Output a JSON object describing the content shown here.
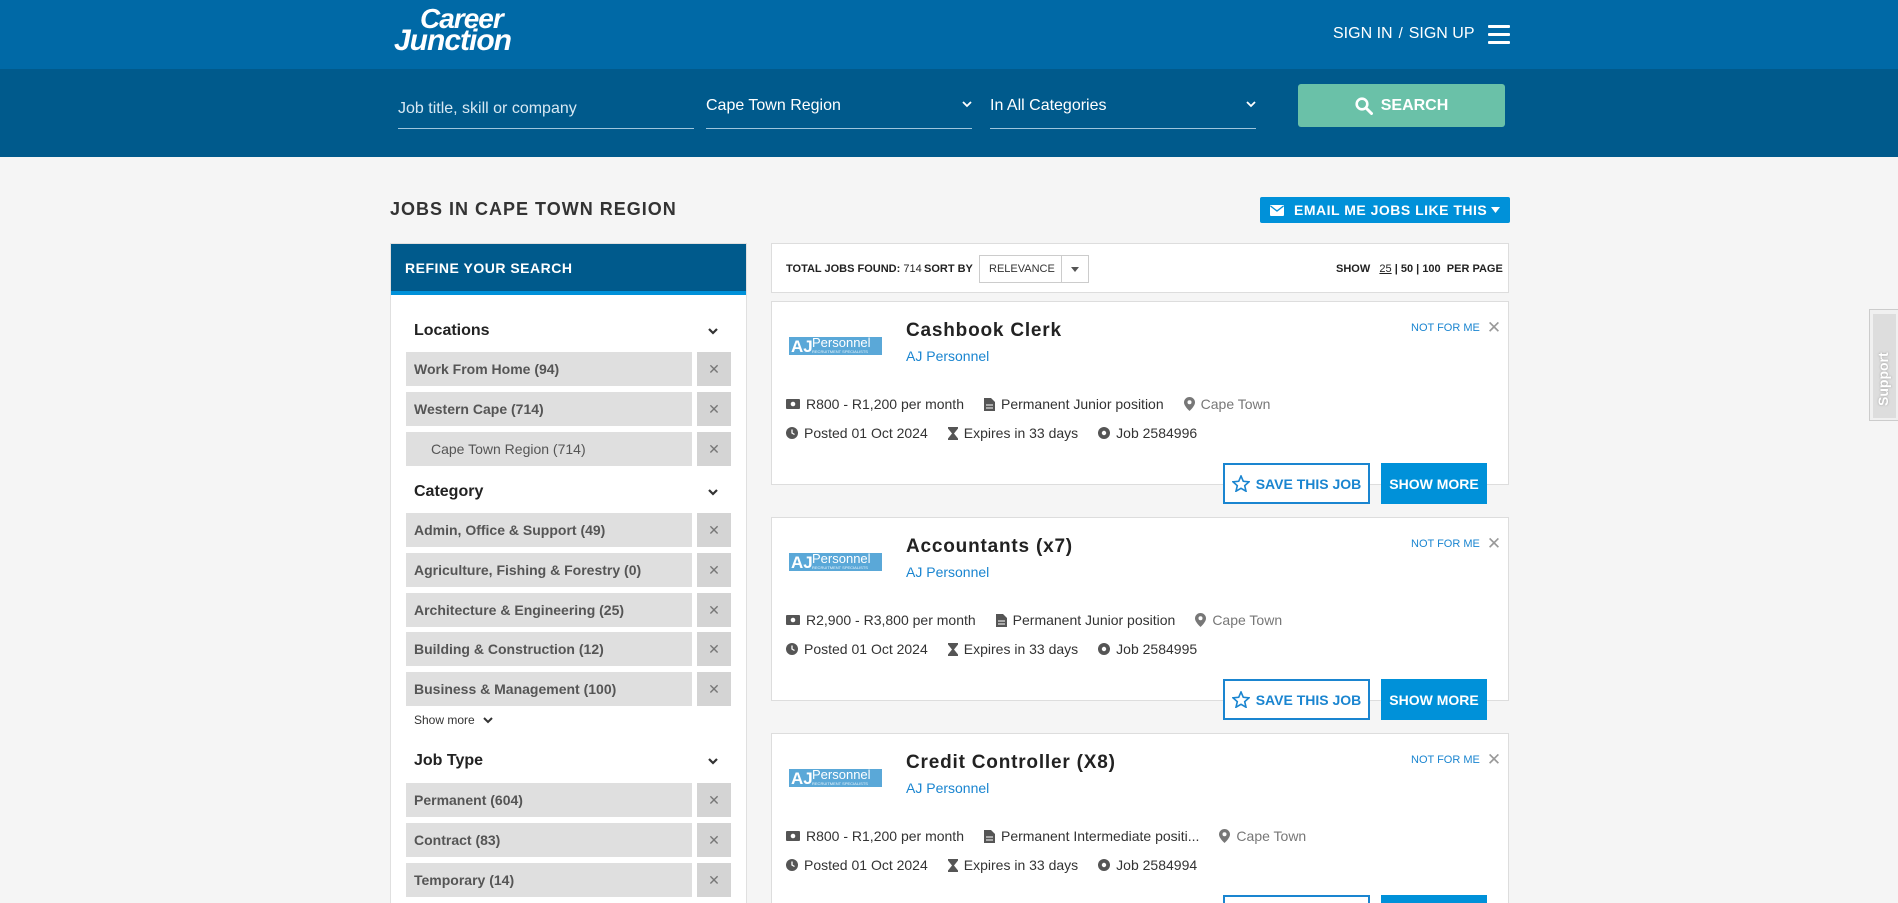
{
  "header": {
    "logo_line1": "Career",
    "logo_line2": "Junction",
    "sign_in": "SIGN IN",
    "separator": "/",
    "sign_up": "SIGN UP"
  },
  "search": {
    "keyword_placeholder": "Job title, skill or company",
    "region_value": "Cape Town Region",
    "category_value": "In All Categories",
    "button_label": "SEARCH"
  },
  "page": {
    "title": "JOBS IN CAPE TOWN REGION",
    "email_button": "EMAIL ME JOBS LIKE THIS"
  },
  "sidebar": {
    "heading": "REFINE YOUR SEARCH",
    "groups": [
      {
        "title": "Locations",
        "items": [
          "Work From Home (94)",
          "Western Cape (714)",
          "Cape Town Region (714)"
        ]
      },
      {
        "title": "Category",
        "items": [
          "Admin, Office & Support (49)",
          "Agriculture, Fishing & Forestry (0)",
          "Architecture & Engineering (25)",
          "Building & Construction (12)",
          "Business & Management (100)"
        ],
        "show_more": "Show more"
      },
      {
        "title": "Job Type",
        "items": [
          "Permanent (604)",
          "Contract (83)",
          "Temporary (14)"
        ]
      }
    ]
  },
  "toolbar": {
    "total_label": "TOTAL JOBS FOUND:",
    "total_value": "714",
    "sort_label": "SORT BY",
    "sort_value": "RELEVANCE",
    "show_label": "SHOW",
    "per_page_options": [
      "25",
      "50",
      "100"
    ],
    "per_page_suffix": "PER PAGE"
  },
  "jobs": [
    {
      "title": "Cashbook Clerk",
      "company": "AJ Personnel",
      "salary": "R800 - R1,200 per month",
      "position": "Permanent Junior position",
      "location": "Cape Town",
      "posted": "Posted 01 Oct 2024",
      "expires": "Expires in 33 days",
      "job_ref": "Job 2584996"
    },
    {
      "title": "Accountants (x7)",
      "company": "AJ Personnel",
      "salary": "R2,900 - R3,800 per month",
      "position": "Permanent Junior position",
      "location": "Cape Town",
      "posted": "Posted 01 Oct 2024",
      "expires": "Expires in 33 days",
      "job_ref": "Job 2584995"
    },
    {
      "title": "Credit Controller (X8)",
      "company": "AJ Personnel",
      "salary": "R800 - R1,200 per month",
      "position": "Permanent Intermediate positi...",
      "location": "Cape Town",
      "posted": "Posted 01 Oct 2024",
      "expires": "Expires in 33 days",
      "job_ref": "Job 2584994"
    }
  ],
  "job_actions": {
    "not_for_me": "NOT FOR ME",
    "save": "SAVE THIS JOB",
    "show_more": "SHOW MORE"
  },
  "company_logo": {
    "big": "AJ",
    "word": "Personnel",
    "tagline": "RECRUITMENT SPECIALISTS"
  },
  "support_tab": "Support",
  "colors": {
    "header_blue": "#0069a6",
    "search_blue": "#005a8c",
    "accent_blue": "#0091d9",
    "link_blue": "#1a85d0",
    "search_green": "#6ac1a8"
  }
}
